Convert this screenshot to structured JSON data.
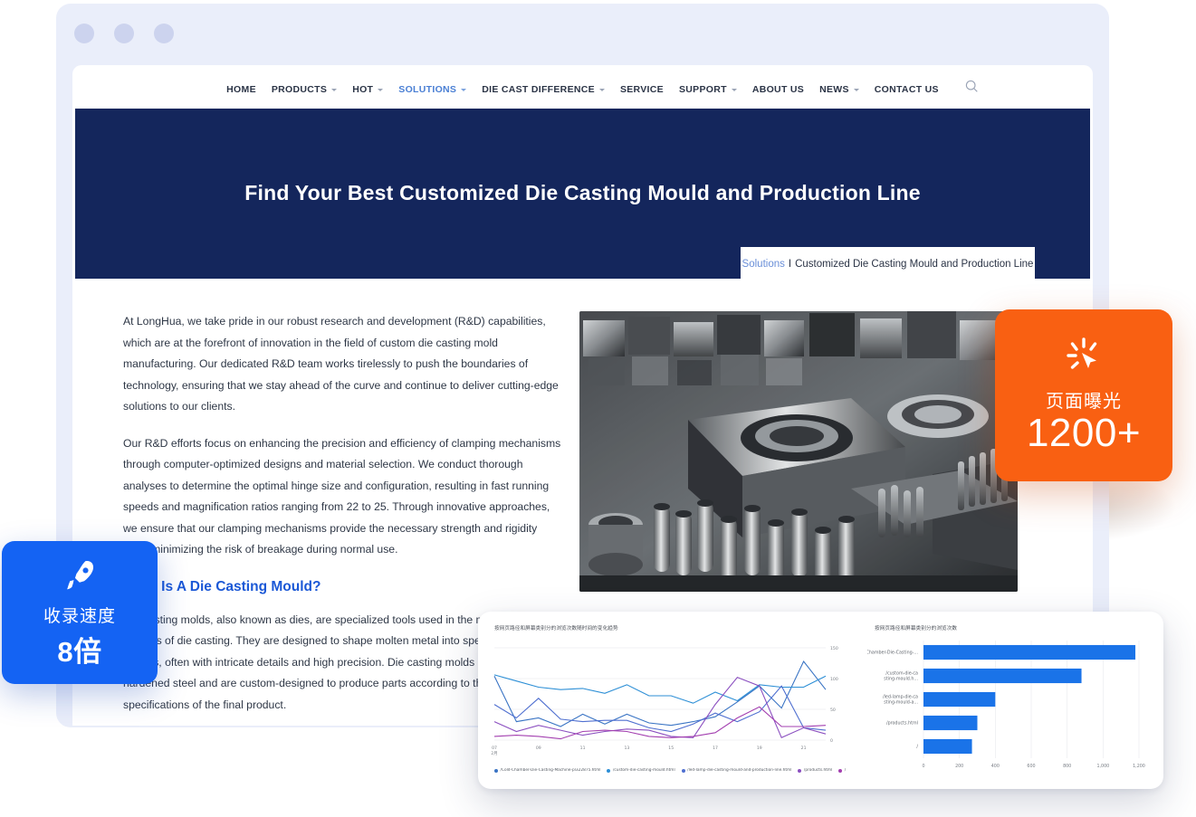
{
  "window": {
    "dots": [
      "dot-1",
      "dot-2",
      "dot-3"
    ]
  },
  "nav": {
    "items": [
      {
        "label": "HOME",
        "has_caret": false,
        "active": false
      },
      {
        "label": "PRODUCTS",
        "has_caret": true,
        "active": false
      },
      {
        "label": "HOT",
        "has_caret": true,
        "active": false
      },
      {
        "label": "SOLUTIONS",
        "has_caret": true,
        "active": true
      },
      {
        "label": "DIE CAST DIFFERENCE",
        "has_caret": true,
        "active": false
      },
      {
        "label": "SERVICE",
        "has_caret": false,
        "active": false
      },
      {
        "label": "SUPPORT",
        "has_caret": true,
        "active": false
      },
      {
        "label": "ABOUT US",
        "has_caret": false,
        "active": false
      },
      {
        "label": "NEWS",
        "has_caret": true,
        "active": false
      },
      {
        "label": "CONTACT US",
        "has_caret": false,
        "active": false
      }
    ],
    "search_icon": "search-icon",
    "active_color": "#4a7fd4"
  },
  "hero": {
    "title": "Find Your Best Customized Die Casting Mould and Production Line",
    "background_color": "#14265c",
    "breadcrumb": {
      "link": "Solutions",
      "separator": "I",
      "current": "Customized Die Casting Mould and Production Line"
    }
  },
  "article": {
    "paragraphs": [
      "At LongHua, we take pride in our robust research and development (R&D) capabilities, which are at the forefront of innovation in the field of custom die casting mold manufacturing. Our dedicated R&D team works tirelessly to push the boundaries of technology, ensuring that we stay ahead of the curve and continue to deliver cutting-edge solutions to our clients.",
      "Our R&D efforts focus on enhancing the precision and efficiency of clamping mechanisms through computer-optimized designs and material selection. We conduct thorough analyses to determine the optimal hinge size and configuration, resulting in fast running speeds and magnification ratios ranging from 22 to 25. Through innovative approaches, we ensure that our clamping mechanisms provide the necessary strength and rigidity while minimizing the risk of breakage during normal use."
    ],
    "heading": "What Is A Die Casting Mould?",
    "heading_color": "#1b58d6",
    "body": "Die casting molds, also known as dies, are specialized tools used in the manufacturing process of die casting. They are designed to shape molten metal into specific geometrical shapes, often with intricate details and high precision. Die casting molds are made of hardened steel and are custom-designed to produce parts according to the exact specifications of the final product.",
    "photo_alt": "die-casting-mould-photo"
  },
  "badges": {
    "blue": {
      "icon": "rocket-icon",
      "label": "收录速度",
      "value": "8倍",
      "color": "#1463f3"
    },
    "orange": {
      "icon": "click-cursor-icon",
      "label": "页面曝光",
      "value": "1200+",
      "color": "#f96012"
    }
  },
  "analytics": {
    "chart_data": [
      {
        "type": "line",
        "title": "按网页路径和屏幕类别分的浏览次数随时间的变化趋势",
        "xlabel": "2月",
        "ylabel": "",
        "x": [
          "07",
          "08",
          "09",
          "10",
          "11",
          "12",
          "13",
          "14",
          "15",
          "16",
          "17",
          "18",
          "19",
          "20",
          "21",
          "22"
        ],
        "xticks": [
          "07",
          "09",
          "11",
          "13",
          "15",
          "17",
          "19",
          "21"
        ],
        "yticks": [
          0,
          50,
          100,
          150
        ],
        "ylim": [
          0,
          150
        ],
        "grid": true,
        "legend_position": "bottom",
        "series": [
          {
            "name": "/Cold-Chamber-Die-Casting-Machine-pl322875.html",
            "color": "#3a74c4",
            "values": [
              104,
              30,
              36,
              22,
              42,
              26,
              42,
              28,
              24,
              30,
              38,
              62,
              88,
              52,
              128,
              82
            ]
          },
          {
            "name": "/custom-die-casting-mould.html",
            "color": "#2d8fd6",
            "values": [
              106,
              96,
              86,
              82,
              84,
              76,
              90,
              72,
              72,
              60,
              78,
              64,
              90,
              86,
              86,
              104
            ]
          },
          {
            "name": "/led-lamp-die-casting-mould-and-production-line.html",
            "color": "#4f6fd0",
            "values": [
              58,
              36,
              68,
              34,
              30,
              32,
              32,
              20,
              14,
              26,
              44,
              30,
              46,
              88,
              20,
              16
            ]
          },
          {
            "name": "/products.html",
            "color": "#8b4fc0",
            "values": [
              30,
              14,
              24,
              16,
              8,
              14,
              18,
              16,
              6,
              4,
              58,
              102,
              88,
              4,
              20,
              10
            ]
          },
          {
            "name": "/",
            "color": "#a33fb0",
            "values": [
              6,
              8,
              6,
              2,
              14,
              16,
              14,
              6,
              4,
              6,
              12,
              36,
              54,
              22,
              22,
              24
            ]
          }
        ]
      },
      {
        "type": "bar",
        "orientation": "horizontal",
        "title": "按网页路径和屏幕类别分的浏览次数",
        "categories": [
          "/Cold-Chamber-Die-Casting-...",
          "/custom-die-ca sting-mould.h...",
          "/led-lamp-die-ca sting-mould-a...",
          "/products.html",
          "/"
        ],
        "values": [
          1180,
          880,
          400,
          300,
          270
        ],
        "xticks": [
          "0",
          "200",
          "400",
          "600",
          "800",
          "1,000",
          "1,200"
        ],
        "xlim": [
          0,
          1200
        ],
        "bar_color": "#1a73e8",
        "grid": true
      }
    ]
  }
}
